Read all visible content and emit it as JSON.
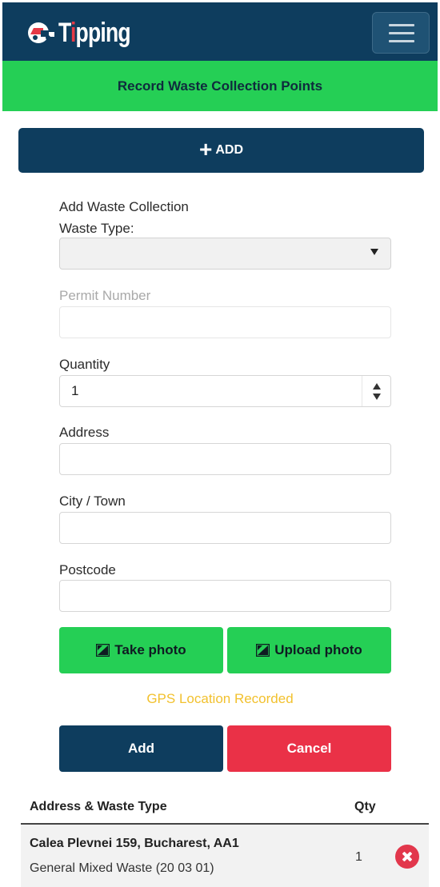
{
  "header": {
    "brand": {
      "prefix": "T",
      "highlight": "i",
      "suffix": "pping"
    },
    "menu_icon": "hamburger-menu-icon",
    "logo_icon": "truck-logo-icon",
    "colors": {
      "nav": "#0e3d5e",
      "accent": "#e63946"
    }
  },
  "banner": {
    "title": "Record Waste Collection Points",
    "color": "#25cf55"
  },
  "add_toggle": {
    "icon": "plus-icon",
    "label": "ADD"
  },
  "form": {
    "heading": "Add Waste Collection",
    "waste_type": {
      "label": "Waste Type:",
      "value": ""
    },
    "permit": {
      "label": "Permit Number",
      "value": ""
    },
    "quantity": {
      "label": "Quantity",
      "value": "1"
    },
    "address": {
      "label": "Address",
      "value": ""
    },
    "city": {
      "label": "City / Town",
      "value": ""
    },
    "postcode": {
      "label": "Postcode",
      "value": ""
    },
    "take_photo": {
      "label": "Take photo",
      "icon": "photo-icon"
    },
    "upload_photo": {
      "label": "Upload photo",
      "icon": "photo-icon"
    },
    "gps_status": "GPS Location Recorded",
    "add_label": "Add",
    "cancel_label": "Cancel"
  },
  "table": {
    "columns": [
      "Address & Waste Type",
      "Qty"
    ],
    "rows": [
      {
        "address": "Calea Plevnei 159, Bucharest, AA1",
        "waste": "General Mixed Waste (20 03 01)",
        "qty": "1",
        "delete_icon": "remove-circle-icon"
      }
    ]
  }
}
